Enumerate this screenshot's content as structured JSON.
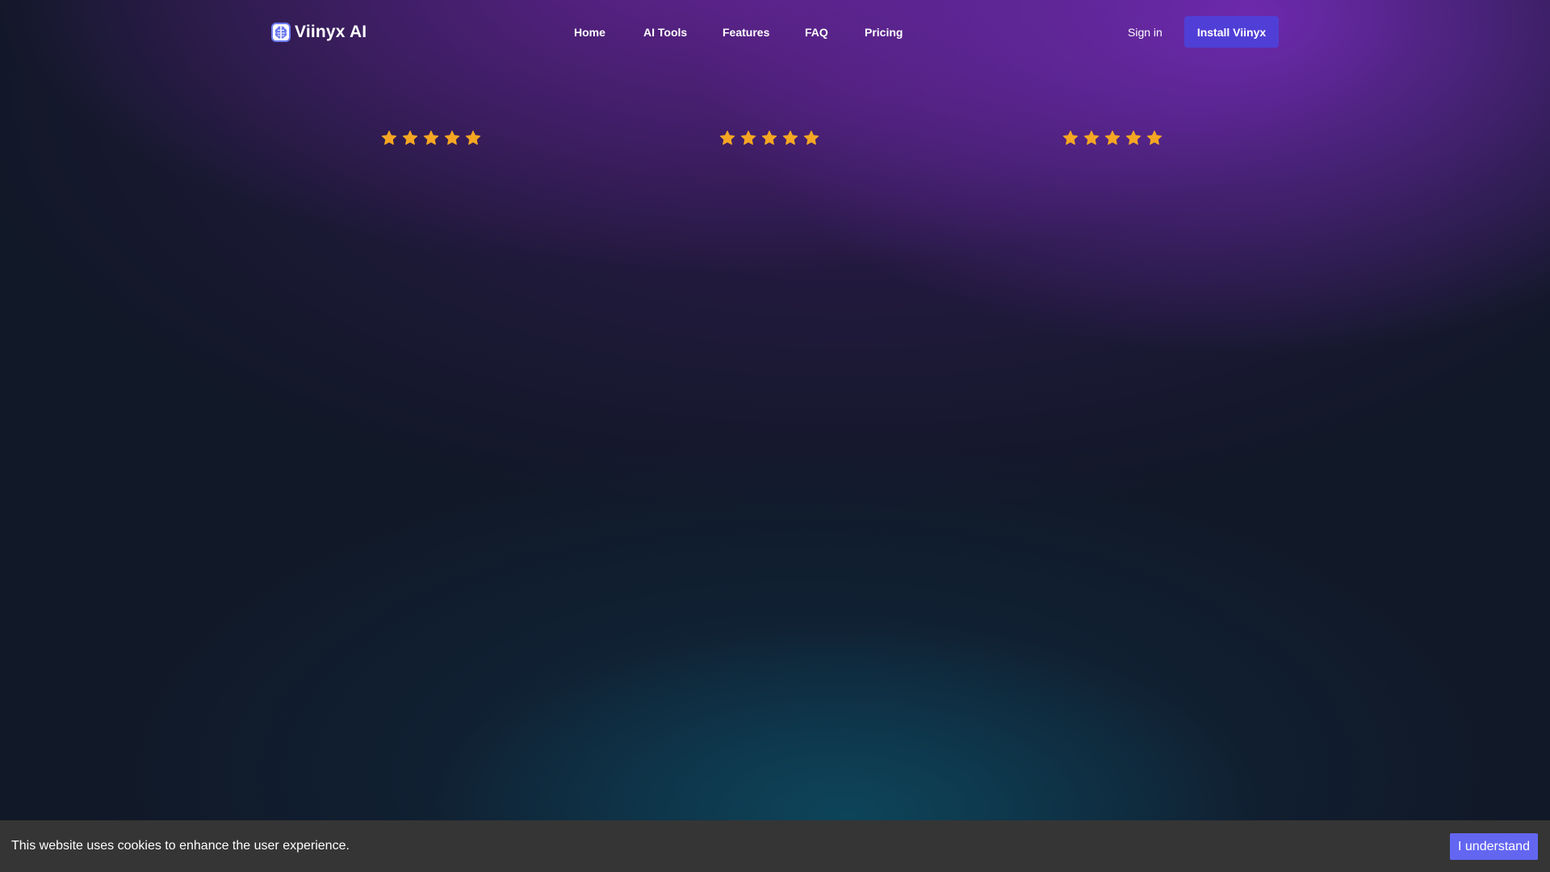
{
  "brand": {
    "name": "Viinyx AI",
    "logo_icon": "brain-icon",
    "logo_color": "#6d7cf2"
  },
  "nav": {
    "items": [
      {
        "label": "Home"
      },
      {
        "label": "AI Tools"
      },
      {
        "label": "Features"
      },
      {
        "label": "FAQ"
      },
      {
        "label": "Pricing"
      }
    ]
  },
  "auth": {
    "signin_label": "Sign in",
    "install_label": "Install Viinyx",
    "install_color": "#4f3fd6"
  },
  "ratings": [
    {
      "stars": 5,
      "max": 5
    },
    {
      "stars": 5,
      "max": 5
    },
    {
      "stars": 5,
      "max": 5
    }
  ],
  "star_color": "#f5a623",
  "cookie": {
    "message": "This website uses cookies to enhance the user experience.",
    "button_label": "I understand",
    "button_color": "#6366f1"
  }
}
